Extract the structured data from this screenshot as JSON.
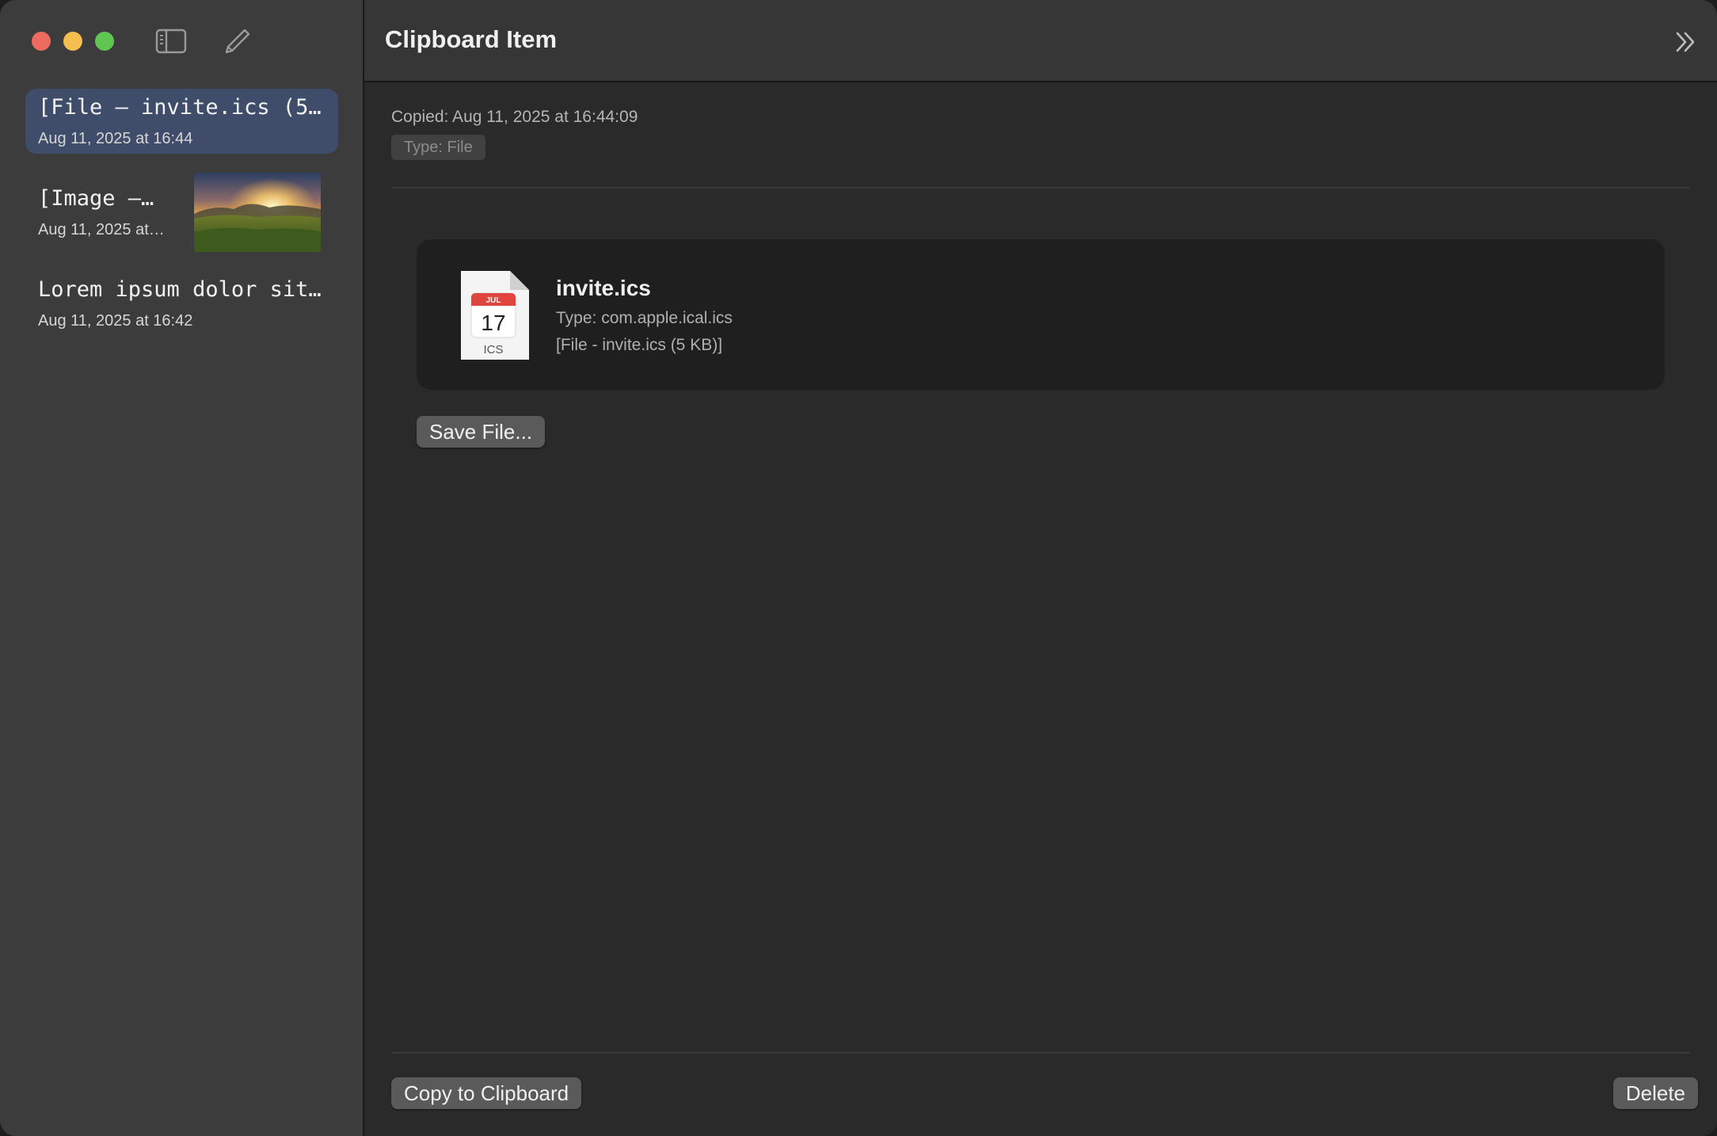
{
  "sidebar": {
    "items": [
      {
        "title": "[File – invite.ics (5…",
        "date": "Aug 11, 2025 at 16:44",
        "selected": true
      },
      {
        "title": "[Image –…",
        "date": "Aug 11, 2025 at…",
        "thumbnail": "sunset-landscape"
      },
      {
        "title": "Lorem ipsum dolor sit…",
        "date": "Aug 11, 2025 at 16:42"
      }
    ]
  },
  "header": {
    "title": "Clipboard Item"
  },
  "detail": {
    "copied": "Copied: Aug 11, 2025 at 16:44:09",
    "type_badge": "Type: File",
    "file": {
      "name": "invite.ics",
      "type": "Type: com.apple.ical.ics",
      "description": "[File - invite.ics (5 KB)]",
      "icon": {
        "month": "JUL",
        "day": "17",
        "ext": "ICS"
      }
    },
    "save_button": "Save File...",
    "copy_button": "Copy to Clipboard",
    "delete_button": "Delete"
  },
  "colors": {
    "selection": "#3f4d6b",
    "sidebar_bg": "#3c3c3c",
    "main_bg": "#2a2a2a",
    "card_bg": "#1f1f1f",
    "calendar_red": "#e0443e"
  }
}
